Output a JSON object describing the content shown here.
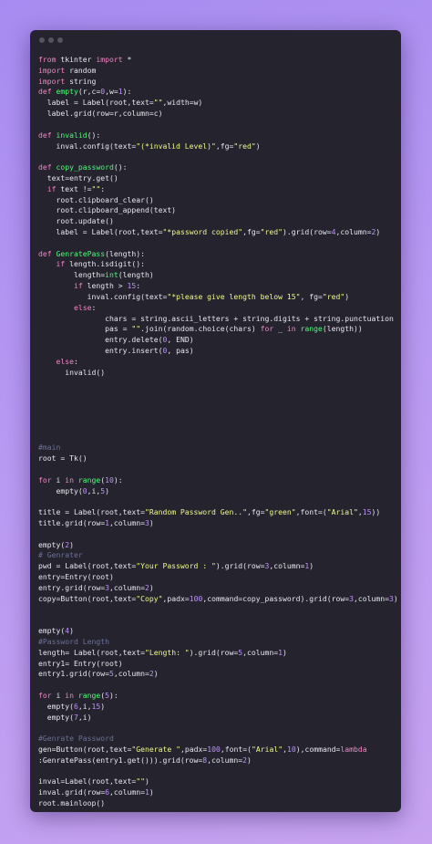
{
  "code_lines": [
    [
      {
        "t": "from",
        "c": "kw"
      },
      {
        "t": " tkinter ",
        "c": "tx"
      },
      {
        "t": "import",
        "c": "kw"
      },
      {
        "t": " *",
        "c": "tx"
      }
    ],
    [
      {
        "t": "import",
        "c": "kw"
      },
      {
        "t": " random",
        "c": "tx"
      }
    ],
    [
      {
        "t": "import",
        "c": "kw"
      },
      {
        "t": " string",
        "c": "tx"
      }
    ],
    [
      {
        "t": "def",
        "c": "kw"
      },
      {
        "t": " ",
        "c": "tx"
      },
      {
        "t": "empty",
        "c": "fn"
      },
      {
        "t": "(r,c=",
        "c": "tx"
      },
      {
        "t": "0",
        "c": "num"
      },
      {
        "t": ",w=",
        "c": "tx"
      },
      {
        "t": "1",
        "c": "num"
      },
      {
        "t": "):",
        "c": "tx"
      }
    ],
    [
      {
        "t": "  label = Label(root,text=",
        "c": "tx"
      },
      {
        "t": "\"\"",
        "c": "str"
      },
      {
        "t": ",width=w)",
        "c": "tx"
      }
    ],
    [
      {
        "t": "  label.grid(row=r,column=c)",
        "c": "tx"
      }
    ],
    [],
    [
      {
        "t": "def",
        "c": "kw"
      },
      {
        "t": " ",
        "c": "tx"
      },
      {
        "t": "invalid",
        "c": "fn"
      },
      {
        "t": "():",
        "c": "tx"
      }
    ],
    [
      {
        "t": "    inval.config(text=",
        "c": "tx"
      },
      {
        "t": "\"(*invalid Level)\"",
        "c": "str"
      },
      {
        "t": ",fg=",
        "c": "tx"
      },
      {
        "t": "\"red\"",
        "c": "str"
      },
      {
        "t": ")",
        "c": "tx"
      }
    ],
    [],
    [
      {
        "t": "def",
        "c": "kw"
      },
      {
        "t": " ",
        "c": "tx"
      },
      {
        "t": "copy_password",
        "c": "fn"
      },
      {
        "t": "():",
        "c": "tx"
      }
    ],
    [
      {
        "t": "  text=entry.get()",
        "c": "tx"
      }
    ],
    [
      {
        "t": "  ",
        "c": "tx"
      },
      {
        "t": "if",
        "c": "kw"
      },
      {
        "t": " text !=",
        "c": "tx"
      },
      {
        "t": "\"\"",
        "c": "str"
      },
      {
        "t": ":",
        "c": "tx"
      }
    ],
    [
      {
        "t": "    root.clipboard_clear()",
        "c": "tx"
      }
    ],
    [
      {
        "t": "    root.clipboard_append(text)",
        "c": "tx"
      }
    ],
    [
      {
        "t": "    root.update()",
        "c": "tx"
      }
    ],
    [
      {
        "t": "    label = Label(root,text=",
        "c": "tx"
      },
      {
        "t": "\"*password copied\"",
        "c": "str"
      },
      {
        "t": ",fg=",
        "c": "tx"
      },
      {
        "t": "\"red\"",
        "c": "str"
      },
      {
        "t": ").grid(row=",
        "c": "tx"
      },
      {
        "t": "4",
        "c": "num"
      },
      {
        "t": ",column=",
        "c": "tx"
      },
      {
        "t": "2",
        "c": "num"
      },
      {
        "t": ")",
        "c": "tx"
      }
    ],
    [],
    [
      {
        "t": "def",
        "c": "kw"
      },
      {
        "t": " ",
        "c": "tx"
      },
      {
        "t": "GenratePass",
        "c": "fn"
      },
      {
        "t": "(length):",
        "c": "tx"
      }
    ],
    [
      {
        "t": "    ",
        "c": "tx"
      },
      {
        "t": "if",
        "c": "kw"
      },
      {
        "t": " length.isdigit():",
        "c": "tx"
      }
    ],
    [
      {
        "t": "        length=",
        "c": "tx"
      },
      {
        "t": "int",
        "c": "fn"
      },
      {
        "t": "(length)",
        "c": "tx"
      }
    ],
    [
      {
        "t": "        ",
        "c": "tx"
      },
      {
        "t": "if",
        "c": "kw"
      },
      {
        "t": " length > ",
        "c": "tx"
      },
      {
        "t": "15",
        "c": "num"
      },
      {
        "t": ":",
        "c": "tx"
      }
    ],
    [
      {
        "t": "           inval.config(text=",
        "c": "tx"
      },
      {
        "t": "\"*please give length below 15\"",
        "c": "str"
      },
      {
        "t": ", fg=",
        "c": "tx"
      },
      {
        "t": "\"red\"",
        "c": "str"
      },
      {
        "t": ")",
        "c": "tx"
      }
    ],
    [
      {
        "t": "        ",
        "c": "tx"
      },
      {
        "t": "else",
        "c": "kw"
      },
      {
        "t": ":",
        "c": "tx"
      }
    ],
    [
      {
        "t": "               chars = string.ascii_letters + string.digits + string.punctuation",
        "c": "tx"
      }
    ],
    [
      {
        "t": "               pas = ",
        "c": "tx"
      },
      {
        "t": "\"\"",
        "c": "str"
      },
      {
        "t": ".join(random.choice(chars) ",
        "c": "tx"
      },
      {
        "t": "for",
        "c": "kw"
      },
      {
        "t": " _ ",
        "c": "tx"
      },
      {
        "t": "in",
        "c": "kw"
      },
      {
        "t": " ",
        "c": "tx"
      },
      {
        "t": "range",
        "c": "fn"
      },
      {
        "t": "(length))",
        "c": "tx"
      }
    ],
    [
      {
        "t": "               entry.delete(",
        "c": "tx"
      },
      {
        "t": "0",
        "c": "num"
      },
      {
        "t": ", END)",
        "c": "tx"
      }
    ],
    [
      {
        "t": "               entry.insert(",
        "c": "tx"
      },
      {
        "t": "0",
        "c": "num"
      },
      {
        "t": ", pas)",
        "c": "tx"
      }
    ],
    [
      {
        "t": "    ",
        "c": "tx"
      },
      {
        "t": "else",
        "c": "kw"
      },
      {
        "t": ":",
        "c": "tx"
      }
    ],
    [
      {
        "t": "      invalid()",
        "c": "tx"
      }
    ],
    [],
    [],
    [],
    [],
    [],
    [],
    [
      {
        "t": "#main",
        "c": "cm"
      }
    ],
    [
      {
        "t": "root = Tk()",
        "c": "tx"
      }
    ],
    [],
    [
      {
        "t": "for",
        "c": "kw"
      },
      {
        "t": " i ",
        "c": "tx"
      },
      {
        "t": "in",
        "c": "kw"
      },
      {
        "t": " ",
        "c": "tx"
      },
      {
        "t": "range",
        "c": "fn"
      },
      {
        "t": "(",
        "c": "tx"
      },
      {
        "t": "10",
        "c": "num"
      },
      {
        "t": "):",
        "c": "tx"
      }
    ],
    [
      {
        "t": "    empty(",
        "c": "tx"
      },
      {
        "t": "0",
        "c": "num"
      },
      {
        "t": ",i,",
        "c": "tx"
      },
      {
        "t": "5",
        "c": "num"
      },
      {
        "t": ")",
        "c": "tx"
      }
    ],
    [],
    [
      {
        "t": "title = Label(root,text=",
        "c": "tx"
      },
      {
        "t": "\"Random Password Gen..\"",
        "c": "str"
      },
      {
        "t": ",fg=",
        "c": "tx"
      },
      {
        "t": "\"green\"",
        "c": "str"
      },
      {
        "t": ",font=(",
        "c": "tx"
      },
      {
        "t": "\"Arial\"",
        "c": "str"
      },
      {
        "t": ",",
        "c": "tx"
      },
      {
        "t": "15",
        "c": "num"
      },
      {
        "t": "))",
        "c": "tx"
      }
    ],
    [
      {
        "t": "title.grid(row=",
        "c": "tx"
      },
      {
        "t": "1",
        "c": "num"
      },
      {
        "t": ",column=",
        "c": "tx"
      },
      {
        "t": "3",
        "c": "num"
      },
      {
        "t": ")",
        "c": "tx"
      }
    ],
    [],
    [
      {
        "t": "empty(",
        "c": "tx"
      },
      {
        "t": "2",
        "c": "num"
      },
      {
        "t": ")",
        "c": "tx"
      }
    ],
    [
      {
        "t": "# Genrater",
        "c": "cm"
      }
    ],
    [
      {
        "t": "pwd = Label(root,text=",
        "c": "tx"
      },
      {
        "t": "\"Your Password : \"",
        "c": "str"
      },
      {
        "t": ").grid(row=",
        "c": "tx"
      },
      {
        "t": "3",
        "c": "num"
      },
      {
        "t": ",column=",
        "c": "tx"
      },
      {
        "t": "1",
        "c": "num"
      },
      {
        "t": ")",
        "c": "tx"
      }
    ],
    [
      {
        "t": "entry=Entry(root)",
        "c": "tx"
      }
    ],
    [
      {
        "t": "entry.grid(row=",
        "c": "tx"
      },
      {
        "t": "3",
        "c": "num"
      },
      {
        "t": ",column=",
        "c": "tx"
      },
      {
        "t": "2",
        "c": "num"
      },
      {
        "t": ")",
        "c": "tx"
      }
    ],
    [
      {
        "t": "copy=Button(root,text=",
        "c": "tx"
      },
      {
        "t": "\"Copy\"",
        "c": "str"
      },
      {
        "t": ",padx=",
        "c": "tx"
      },
      {
        "t": "100",
        "c": "num"
      },
      {
        "t": ",command=copy_password).grid(row=",
        "c": "tx"
      },
      {
        "t": "3",
        "c": "num"
      },
      {
        "t": ",column=",
        "c": "tx"
      },
      {
        "t": "3",
        "c": "num"
      },
      {
        "t": ")",
        "c": "tx"
      }
    ],
    [],
    [],
    [
      {
        "t": "empty(",
        "c": "tx"
      },
      {
        "t": "4",
        "c": "num"
      },
      {
        "t": ")",
        "c": "tx"
      }
    ],
    [
      {
        "t": "#Password Length",
        "c": "cm"
      }
    ],
    [
      {
        "t": "length= Label(root,text=",
        "c": "tx"
      },
      {
        "t": "\"Length: \"",
        "c": "str"
      },
      {
        "t": ").grid(row=",
        "c": "tx"
      },
      {
        "t": "5",
        "c": "num"
      },
      {
        "t": ",column=",
        "c": "tx"
      },
      {
        "t": "1",
        "c": "num"
      },
      {
        "t": ")",
        "c": "tx"
      }
    ],
    [
      {
        "t": "entry1= Entry(root)",
        "c": "tx"
      }
    ],
    [
      {
        "t": "entry1.grid(row=",
        "c": "tx"
      },
      {
        "t": "5",
        "c": "num"
      },
      {
        "t": ",column=",
        "c": "tx"
      },
      {
        "t": "2",
        "c": "num"
      },
      {
        "t": ")",
        "c": "tx"
      }
    ],
    [],
    [
      {
        "t": "for",
        "c": "kw"
      },
      {
        "t": " i ",
        "c": "tx"
      },
      {
        "t": "in",
        "c": "kw"
      },
      {
        "t": " ",
        "c": "tx"
      },
      {
        "t": "range",
        "c": "fn"
      },
      {
        "t": "(",
        "c": "tx"
      },
      {
        "t": "5",
        "c": "num"
      },
      {
        "t": "):",
        "c": "tx"
      }
    ],
    [
      {
        "t": "  empty(",
        "c": "tx"
      },
      {
        "t": "6",
        "c": "num"
      },
      {
        "t": ",i,",
        "c": "tx"
      },
      {
        "t": "15",
        "c": "num"
      },
      {
        "t": ")",
        "c": "tx"
      }
    ],
    [
      {
        "t": "  empty(",
        "c": "tx"
      },
      {
        "t": "7",
        "c": "num"
      },
      {
        "t": ",i)",
        "c": "tx"
      }
    ],
    [],
    [
      {
        "t": "#Genrate Password",
        "c": "cm"
      }
    ],
    [
      {
        "t": "gen=Button(root,text=",
        "c": "tx"
      },
      {
        "t": "\"Generate \"",
        "c": "str"
      },
      {
        "t": ",padx=",
        "c": "tx"
      },
      {
        "t": "100",
        "c": "num"
      },
      {
        "t": ",font=(",
        "c": "tx"
      },
      {
        "t": "\"Arial\"",
        "c": "str"
      },
      {
        "t": ",",
        "c": "tx"
      },
      {
        "t": "10",
        "c": "num"
      },
      {
        "t": "),command=",
        "c": "tx"
      },
      {
        "t": "lambda",
        "c": "kw"
      }
    ],
    [
      {
        "t": ":GenratePass(entry1.get())).grid(row=",
        "c": "tx"
      },
      {
        "t": "8",
        "c": "num"
      },
      {
        "t": ",column=",
        "c": "tx"
      },
      {
        "t": "2",
        "c": "num"
      },
      {
        "t": ")",
        "c": "tx"
      }
    ],
    [],
    [
      {
        "t": "inval=Label(root,text=",
        "c": "tx"
      },
      {
        "t": "\"\"",
        "c": "str"
      },
      {
        "t": ")",
        "c": "tx"
      }
    ],
    [
      {
        "t": "inval.grid(row=",
        "c": "tx"
      },
      {
        "t": "6",
        "c": "num"
      },
      {
        "t": ",column=",
        "c": "tx"
      },
      {
        "t": "1",
        "c": "num"
      },
      {
        "t": ")",
        "c": "tx"
      }
    ],
    [
      {
        "t": "root.mainloop()",
        "c": "tx"
      }
    ]
  ]
}
